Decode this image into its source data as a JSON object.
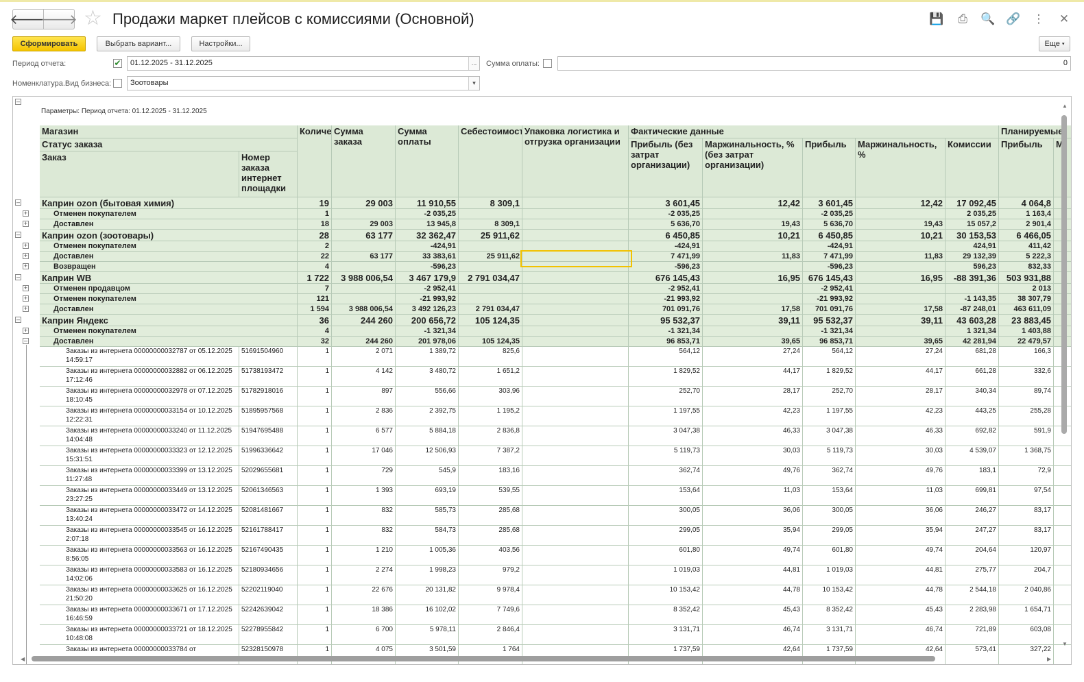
{
  "window": {
    "title": "Продажи маркет плейсов с комиссиями (Основной)"
  },
  "toolbar": {
    "generate": "Сформировать",
    "choose_variant": "Выбрать вариант...",
    "settings": "Настройки...",
    "more": "Еще"
  },
  "filters": {
    "period_label": "Период отчета:",
    "period_checked": true,
    "period_value": "01.12.2025 - 31.12.2025",
    "payment_label": "Сумма оплаты:",
    "payment_checked": false,
    "payment_value": "0",
    "business_label": "Номенклатура.Вид бизнеса:",
    "business_checked": false,
    "business_value": "Зоотовары"
  },
  "report": {
    "params_line": "Параметры: Период отчета: 01.12.2025 - 31.12.2025",
    "headers": {
      "shop": "Магазин",
      "status": "Статус заказа",
      "order": "Заказ",
      "platform_order": "Номер заказа интернет площадки",
      "qty": "Количество",
      "order_sum": "Сумма заказа",
      "payment_sum": "Сумма оплаты",
      "cost": "Себестоимость",
      "packing": "Упаковка логистика и отгрузка организации",
      "actual": "Фактические данные",
      "profit_no_costs": "Прибыль (без затрат организации)",
      "margin_no_costs": "Маржинальность, % (без затрат организации)",
      "profit": "Прибыль",
      "margin": "Маржинальность, %",
      "commission": "Комиссии",
      "planned": "Планируемые",
      "plan_profit": "Прибыль",
      "plan_next": "М"
    },
    "rows": [
      {
        "kind": "g1",
        "c": [
          "Каприн ozon (бытовая химия)",
          "",
          "19",
          "29 003",
          "11 910,55",
          "8 309,1",
          "",
          "3 601,45",
          "12,42",
          "3 601,45",
          "12,42",
          "17 092,45",
          "4 064,8"
        ]
      },
      {
        "kind": "g2",
        "c": [
          "Отменен покупателем",
          "",
          "1",
          "",
          "-2 035,25",
          "",
          "",
          "-2 035,25",
          "",
          "-2 035,25",
          "",
          "2 035,25",
          "1 163,4"
        ]
      },
      {
        "kind": "g2",
        "c": [
          "Доставлен",
          "",
          "18",
          "29 003",
          "13 945,8",
          "8 309,1",
          "",
          "5 636,70",
          "19,43",
          "5 636,70",
          "19,43",
          "15 057,2",
          "2 901,4"
        ]
      },
      {
        "kind": "g1",
        "c": [
          "Каприн ozon (зоотовары)",
          "",
          "28",
          "63 177",
          "32 362,47",
          "25 911,62",
          "",
          "6 450,85",
          "10,21",
          "6 450,85",
          "10,21",
          "30 153,53",
          "6 466,05"
        ]
      },
      {
        "kind": "g2",
        "c": [
          "Отменен покупателем",
          "",
          "2",
          "",
          "-424,91",
          "",
          "",
          "-424,91",
          "",
          "-424,91",
          "",
          "424,91",
          "411,42"
        ]
      },
      {
        "kind": "g2",
        "c": [
          "Доставлен",
          "",
          "22",
          "63 177",
          "33 383,61",
          "25 911,62",
          "",
          "7 471,99",
          "11,83",
          "7 471,99",
          "11,83",
          "29 132,39",
          "5 222,3"
        ]
      },
      {
        "kind": "g2",
        "c": [
          "Возвращен",
          "",
          "4",
          "",
          "-596,23",
          "",
          "",
          "-596,23",
          "",
          "-596,23",
          "",
          "596,23",
          "832,33"
        ]
      },
      {
        "kind": "g1",
        "c": [
          "Каприн WB",
          "",
          "1 722",
          "3 988 006,54",
          "3 467 179,9",
          "2 791 034,47",
          "",
          "676 145,43",
          "16,95",
          "676 145,43",
          "16,95",
          "-88 391,36",
          "503 931,88"
        ]
      },
      {
        "kind": "g2",
        "c": [
          "Отменен продавцом",
          "",
          "7",
          "",
          "-2 952,41",
          "",
          "",
          "-2 952,41",
          "",
          "-2 952,41",
          "",
          "",
          "2 013"
        ]
      },
      {
        "kind": "g2",
        "c": [
          "Отменен покупателем",
          "",
          "121",
          "",
          "-21 993,92",
          "",
          "",
          "-21 993,92",
          "",
          "-21 993,92",
          "",
          "-1 143,35",
          "38 307,79"
        ]
      },
      {
        "kind": "g2",
        "c": [
          "Доставлен",
          "",
          "1 594",
          "3 988 006,54",
          "3 492 126,23",
          "2 791 034,47",
          "",
          "701 091,76",
          "17,58",
          "701 091,76",
          "17,58",
          "-87 248,01",
          "463 611,09"
        ]
      },
      {
        "kind": "g1",
        "c": [
          "Каприн Яндекс",
          "",
          "36",
          "244 260",
          "200 656,72",
          "105 124,35",
          "",
          "95 532,37",
          "39,11",
          "95 532,37",
          "39,11",
          "43 603,28",
          "23 883,45"
        ]
      },
      {
        "kind": "g2",
        "c": [
          "Отменен покупателем",
          "",
          "4",
          "",
          "-1 321,34",
          "",
          "",
          "-1 321,34",
          "",
          "-1 321,34",
          "",
          "1 321,34",
          "1 403,88"
        ]
      },
      {
        "kind": "g2",
        "c": [
          "Доставлен",
          "",
          "32",
          "244 260",
          "201 978,06",
          "105 124,35",
          "",
          "96 853,71",
          "39,65",
          "96 853,71",
          "39,65",
          "42 281,94",
          "22 479,57"
        ]
      },
      {
        "kind": "det",
        "c": [
          "Заказы из интернета 00000000032787 от 05.12.2025 14:59:17",
          "51691504960",
          "1",
          "2 071",
          "1 389,72",
          "825,6",
          "",
          "564,12",
          "27,24",
          "564,12",
          "27,24",
          "681,28",
          "166,3"
        ]
      },
      {
        "kind": "det",
        "c": [
          "Заказы из интернета 00000000032882 от 06.12.2025 17:12:46",
          "51738193472",
          "1",
          "4 142",
          "3 480,72",
          "1 651,2",
          "",
          "1 829,52",
          "44,17",
          "1 829,52",
          "44,17",
          "661,28",
          "332,6"
        ]
      },
      {
        "kind": "det",
        "c": [
          "Заказы из интернета 00000000032978 от 07.12.2025 18:10:45",
          "51782918016",
          "1",
          "897",
          "556,66",
          "303,96",
          "",
          "252,70",
          "28,17",
          "252,70",
          "28,17",
          "340,34",
          "89,74"
        ]
      },
      {
        "kind": "det",
        "c": [
          "Заказы из интернета 00000000033154 от 10.12.2025 12:22:31",
          "51895957568",
          "1",
          "2 836",
          "2 392,75",
          "1 195,2",
          "",
          "1 197,55",
          "42,23",
          "1 197,55",
          "42,23",
          "443,25",
          "255,28"
        ]
      },
      {
        "kind": "det",
        "c": [
          "Заказы из интернета 00000000033240 от 11.12.2025 14:04:48",
          "51947695488",
          "1",
          "6 577",
          "5 884,18",
          "2 836,8",
          "",
          "3 047,38",
          "46,33",
          "3 047,38",
          "46,33",
          "692,82",
          "591,9"
        ]
      },
      {
        "kind": "det",
        "c": [
          "Заказы из интернета 00000000033323 от 12.12.2025 15:31:51",
          "51996336642",
          "1",
          "17 046",
          "12 506,93",
          "7 387,2",
          "",
          "5 119,73",
          "30,03",
          "5 119,73",
          "30,03",
          "4 539,07",
          "1 368,75"
        ]
      },
      {
        "kind": "det",
        "c": [
          "Заказы из интернета 00000000033399 от 13.12.2025 11:27:48",
          "52029655681",
          "1",
          "729",
          "545,9",
          "183,16",
          "",
          "362,74",
          "49,76",
          "362,74",
          "49,76",
          "183,1",
          "72,9"
        ]
      },
      {
        "kind": "det",
        "c": [
          "Заказы из интернета 00000000033449 от 13.12.2025 23:27:25",
          "52061346563",
          "1",
          "1 393",
          "693,19",
          "539,55",
          "",
          "153,64",
          "11,03",
          "153,64",
          "11,03",
          "699,81",
          "97,54"
        ]
      },
      {
        "kind": "det",
        "c": [
          "Заказы из интернета 00000000033472 от 14.12.2025 13:40:24",
          "52081481667",
          "1",
          "832",
          "585,73",
          "285,68",
          "",
          "300,05",
          "36,06",
          "300,05",
          "36,06",
          "246,27",
          "83,17"
        ]
      },
      {
        "kind": "det",
        "c": [
          "Заказы из интернета 00000000033545 от 16.12.2025 2:07:18",
          "52161788417",
          "1",
          "832",
          "584,73",
          "285,68",
          "",
          "299,05",
          "35,94",
          "299,05",
          "35,94",
          "247,27",
          "83,17"
        ]
      },
      {
        "kind": "det",
        "c": [
          "Заказы из интернета 00000000033563 от 16.12.2025 8:56:05",
          "52167490435",
          "1",
          "1 210",
          "1 005,36",
          "403,56",
          "",
          "601,80",
          "49,74",
          "601,80",
          "49,74",
          "204,64",
          "120,97"
        ]
      },
      {
        "kind": "det",
        "c": [
          "Заказы из интернета 00000000033583 от 16.12.2025 14:02:06",
          "52180934656",
          "1",
          "2 274",
          "1 998,23",
          "979,2",
          "",
          "1 019,03",
          "44,81",
          "1 019,03",
          "44,81",
          "275,77",
          "204,7"
        ]
      },
      {
        "kind": "det",
        "c": [
          "Заказы из интернета 00000000033625 от 16.12.2025 21:50:20",
          "52202119040",
          "1",
          "22 676",
          "20 131,82",
          "9 978,4",
          "",
          "10 153,42",
          "44,78",
          "10 153,42",
          "44,78",
          "2 544,18",
          "2 040,86"
        ]
      },
      {
        "kind": "det",
        "c": [
          "Заказы из интернета 00000000033671 от 17.12.2025 16:46:59",
          "52242639042",
          "1",
          "18 386",
          "16 102,02",
          "7 749,6",
          "",
          "8 352,42",
          "45,43",
          "8 352,42",
          "45,43",
          "2 283,98",
          "1 654,71"
        ]
      },
      {
        "kind": "det",
        "c": [
          "Заказы из интернета 00000000033721 от 18.12.2025 10:48:08",
          "52278955842",
          "1",
          "6 700",
          "5 978,11",
          "2 846,4",
          "",
          "3 131,71",
          "46,74",
          "3 131,71",
          "46,74",
          "721,89",
          "603,08"
        ]
      },
      {
        "kind": "det",
        "c": [
          "Заказы из интернета 00000000033784 от",
          "52328150978",
          "1",
          "4 075",
          "3 501,59",
          "1 764",
          "",
          "1 737,59",
          "42,64",
          "1 737,59",
          "42,64",
          "573,41",
          "327,22"
        ]
      }
    ]
  }
}
